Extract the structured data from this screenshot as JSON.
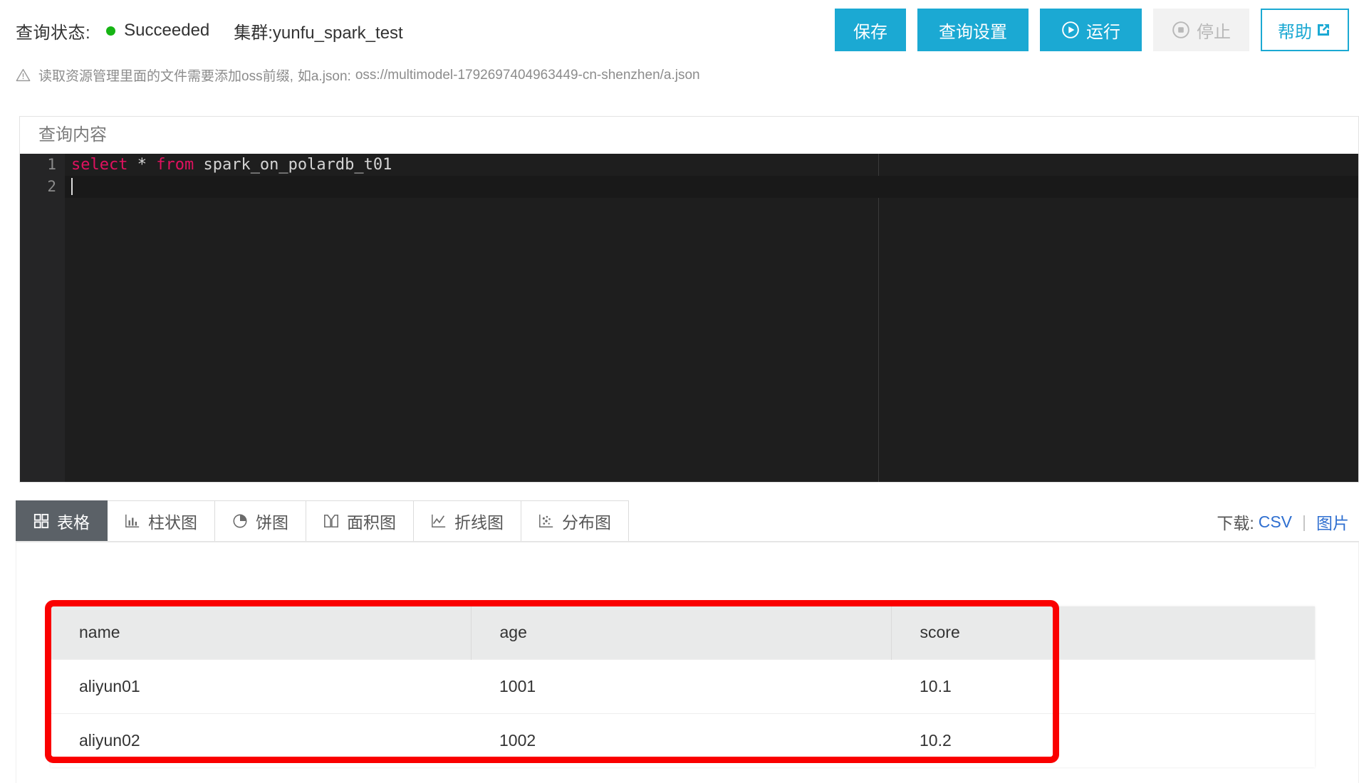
{
  "header": {
    "status_label": "查询状态:",
    "status_value": "Succeeded",
    "status_color": "#16b414",
    "cluster_text": "集群:yunfu_spark_test",
    "buttons": {
      "save": "保存",
      "query_settings": "查询设置",
      "run": "运行",
      "stop": "停止",
      "help": "帮助"
    },
    "accent_color": "#1BA9D3"
  },
  "warning": {
    "text_before": "读取资源管理里面的文件需要添加oss前缀,",
    "text_example_label": "如a.json:",
    "text_path": "oss://multimodel-1792697404963449-cn-shenzhen/a.json"
  },
  "editor": {
    "title": "查询内容",
    "lines": [
      {
        "number": "1",
        "kw1": "select",
        "op": " * ",
        "kw2": "from",
        "ident": " spark_on_polardb_t01"
      },
      {
        "number": "2"
      }
    ],
    "keyword_color": "#e0115f",
    "text_color": "#d4d4d4",
    "background": "#1e1e1e"
  },
  "result_tabs": {
    "items": [
      {
        "label": "表格",
        "icon": "table-icon",
        "active": true
      },
      {
        "label": "柱状图",
        "icon": "bar-chart-icon",
        "active": false
      },
      {
        "label": "饼图",
        "icon": "pie-chart-icon",
        "active": false
      },
      {
        "label": "面积图",
        "icon": "area-chart-icon",
        "active": false
      },
      {
        "label": "折线图",
        "icon": "line-chart-icon",
        "active": false
      },
      {
        "label": "分布图",
        "icon": "scatter-chart-icon",
        "active": false
      }
    ],
    "download_label": "下载:",
    "download_csv": "CSV",
    "download_separator": "|",
    "download_image": "图片"
  },
  "result_table": {
    "columns": [
      "name",
      "age",
      "score"
    ],
    "rows": [
      [
        "aliyun01",
        "1001",
        "10.1"
      ],
      [
        "aliyun02",
        "1002",
        "10.2"
      ]
    ]
  },
  "annotation": {
    "color": "#fa0000"
  }
}
